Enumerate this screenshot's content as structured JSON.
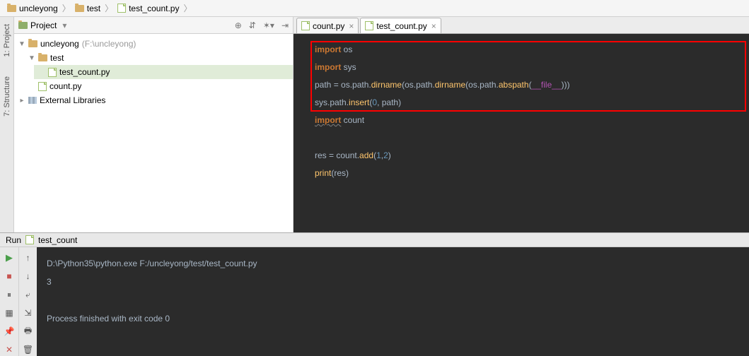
{
  "breadcrumb": [
    {
      "icon": "folder",
      "label": "uncleyong"
    },
    {
      "icon": "folder",
      "label": "test"
    },
    {
      "icon": "pyfile",
      "label": "test_count.py"
    }
  ],
  "sidebar": {
    "tabs": [
      "1: Project",
      "7: Structure"
    ]
  },
  "project": {
    "header_label": "Project",
    "actions": [
      "⊕",
      "⇵",
      "✶▾",
      "⇥"
    ],
    "tree": [
      {
        "tw": "▼",
        "indent": 0,
        "icon": "folder",
        "label": "uncleyong",
        "hint": "(F:\\uncleyong)"
      },
      {
        "tw": "▼",
        "indent": 1,
        "icon": "folder",
        "label": "test",
        "hint": ""
      },
      {
        "tw": "",
        "indent": 2,
        "icon": "pyfile",
        "label": "test_count.py",
        "hint": "",
        "sel": true
      },
      {
        "tw": "",
        "indent": 1,
        "icon": "pyfile",
        "label": "count.py",
        "hint": ""
      },
      {
        "tw": "▸",
        "indent": 0,
        "icon": "lib",
        "label": "External Libraries",
        "hint": ""
      }
    ]
  },
  "editor_tabs": [
    {
      "label": "count.py",
      "active": false
    },
    {
      "label": "test_count.py",
      "active": true
    }
  ],
  "code": {
    "l1": {
      "kw": "import",
      "rest": " os"
    },
    "l2": {
      "kw": "import",
      "rest": " sys"
    },
    "l3_a": "path = os.path.",
    "l3_fn1": "dirname",
    "l3_b": "(os.path.",
    "l3_fn2": "dirname",
    "l3_c": "(os.path.",
    "l3_fn3": "abspath",
    "l3_d": "(",
    "l3_mag": "__file__",
    "l3_e": ")))",
    "l4_a": "sys.path.",
    "l4_fn": "insert",
    "l4_b": "(",
    "l4_n": "0",
    "l4_c": ", path)",
    "l5": {
      "kw": "import",
      "rest": " count"
    },
    "l7_a": "res = count.",
    "l7_fn": "add",
    "l7_b": "(",
    "l7_n1": "1",
    "l7_c": ",",
    "l7_n2": "2",
    "l7_d": ")",
    "l8_fn": "print",
    "l8_b": "(res)"
  },
  "run": {
    "header_label": "Run",
    "config": "test_count",
    "lines": [
      "D:\\Python35\\python.exe F:/uncleyong/test/test_count.py",
      "3",
      "",
      "Process finished with exit code 0"
    ]
  }
}
